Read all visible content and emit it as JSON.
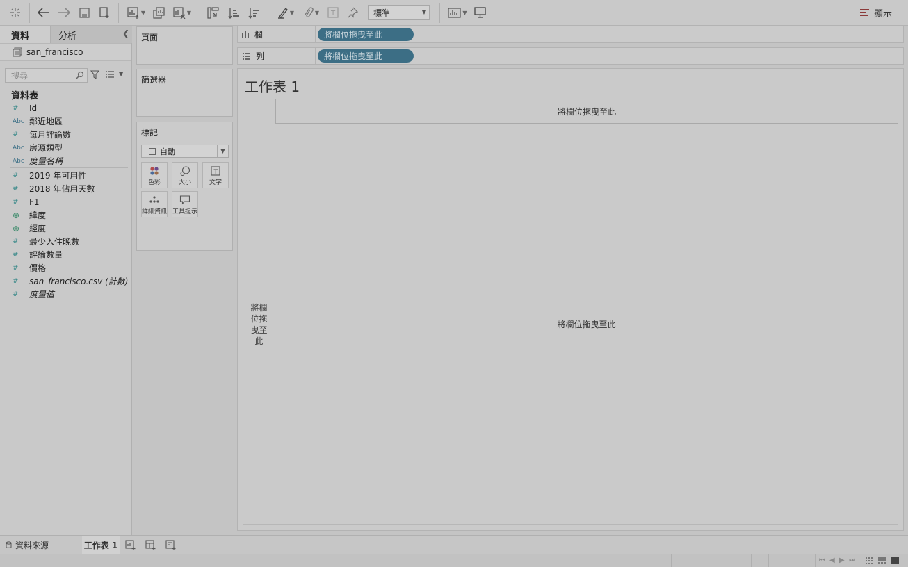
{
  "toolbar": {
    "fit_label": "標準",
    "show_me_label": "顯示"
  },
  "data_pane": {
    "tab_data": "資料",
    "tab_analysis": "分析",
    "datasource_name": "san_francisco",
    "search_placeholder": "搜尋",
    "tables_title": "資料表",
    "fields_group1": [
      {
        "icon": "#",
        "name": "Id"
      },
      {
        "icon": "Abc",
        "name": "鄰近地區"
      },
      {
        "icon": "#",
        "name": "每月評論數"
      },
      {
        "icon": "Abc",
        "name": "房源類型"
      },
      {
        "icon": "Abc",
        "name": "度量名稱"
      }
    ],
    "fields_group2": [
      {
        "icon": "#",
        "name": "2019 年可用性"
      },
      {
        "icon": "#",
        "name": "2018 年佔用天數"
      },
      {
        "icon": "#",
        "name": "F1"
      },
      {
        "icon": "globe",
        "name": "緯度"
      },
      {
        "icon": "globe",
        "name": "經度"
      },
      {
        "icon": "#",
        "name": "最少入住晚數"
      },
      {
        "icon": "#",
        "name": "評論數量"
      },
      {
        "icon": "#",
        "name": "價格"
      },
      {
        "icon": "#",
        "name": "san_francisco.csv (計數)"
      },
      {
        "icon": "#",
        "name": "度量值"
      }
    ]
  },
  "cards": {
    "pages_title": "頁面",
    "filters_title": "篩選器",
    "marks_title": "標記",
    "mark_type": "自動",
    "mark_buttons": {
      "color": "色彩",
      "size": "大小",
      "text": "文字",
      "detail": "詳細資訊",
      "tooltip": "工具提示"
    }
  },
  "shelves": {
    "columns_label": "欄",
    "rows_label": "列",
    "drop_hint": "將欄位拖曳至此"
  },
  "view": {
    "sheet_title": "工作表 1",
    "column_drop": "將欄位拖曳至此",
    "row_drop": "將欄位拖曳至此",
    "body_drop": "將欄位拖曳至此"
  },
  "bottom_tabs": {
    "datasource_tab": "資料來源",
    "sheet_tab": "工作表 1"
  }
}
